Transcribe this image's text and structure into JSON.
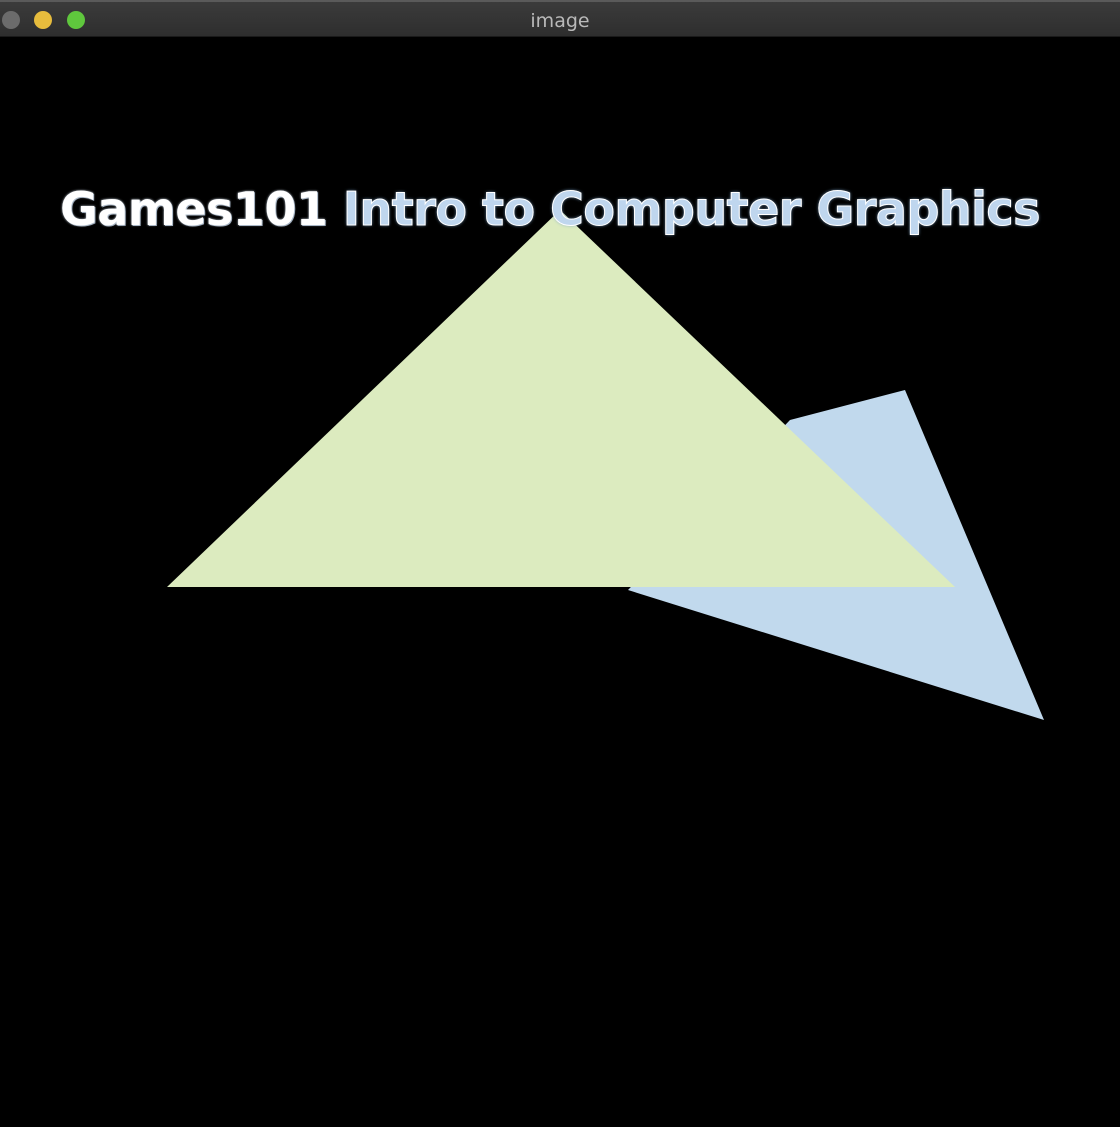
{
  "window": {
    "title": "image"
  },
  "caption": {
    "part1": "Games101",
    "part2": "Intro to Computer Graphics"
  },
  "colors": {
    "background": "#000000",
    "green_triangle": "#dcebbf",
    "blue_triangle": "#c1d9ed",
    "close_button": "#6b6b6b",
    "minimize_button": "#e7bc3d",
    "maximize_button": "#5fc73d"
  },
  "icons": [
    "close-icon",
    "minimize-icon",
    "maximize-icon"
  ]
}
